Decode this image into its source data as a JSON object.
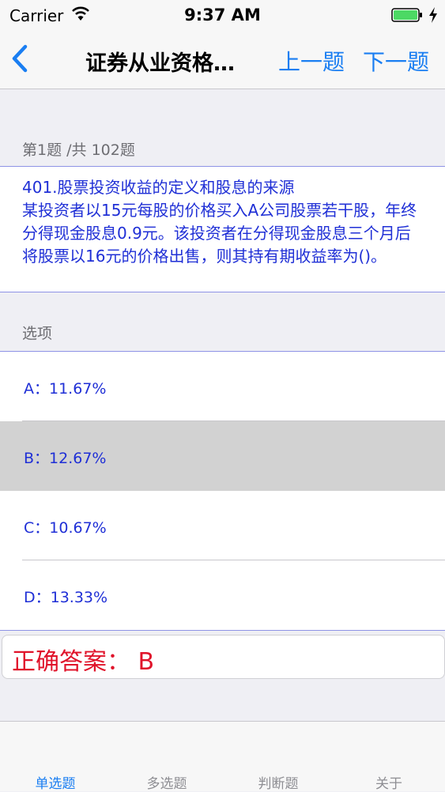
{
  "status_bar": {
    "carrier": "Carrier",
    "time": "9:37 AM"
  },
  "nav": {
    "title": "证券从业资格…",
    "prev_label": "上一题",
    "next_label": "下一题"
  },
  "question": {
    "counter": "第1题 /共 102题",
    "text": "401.股票投资收益的定义和股息的来源\n某投资者以15元每股的价格买入A公司股票若干股，年终分得现金股息0.9元。该投资者在分得现金股息三个月后将股票以16元的价格出售，则其持有期收益率为()。"
  },
  "options_header": "选项",
  "options": [
    {
      "label": "A：11.67%",
      "selected": false
    },
    {
      "label": "B：12.67%",
      "selected": true
    },
    {
      "label": "C：10.67%",
      "selected": false
    },
    {
      "label": "D：13.33%",
      "selected": false
    }
  ],
  "answer": "正确答案： B",
  "tabs": [
    {
      "label": "单选题",
      "active": true
    },
    {
      "label": "多选题",
      "active": false
    },
    {
      "label": "判断题",
      "active": false
    },
    {
      "label": "关于",
      "active": false
    }
  ],
  "colors": {
    "accent": "#1a7ef2",
    "question_text": "#1f2fd6",
    "answer": "#e0132a",
    "selected_row": "#d2d2d2"
  }
}
